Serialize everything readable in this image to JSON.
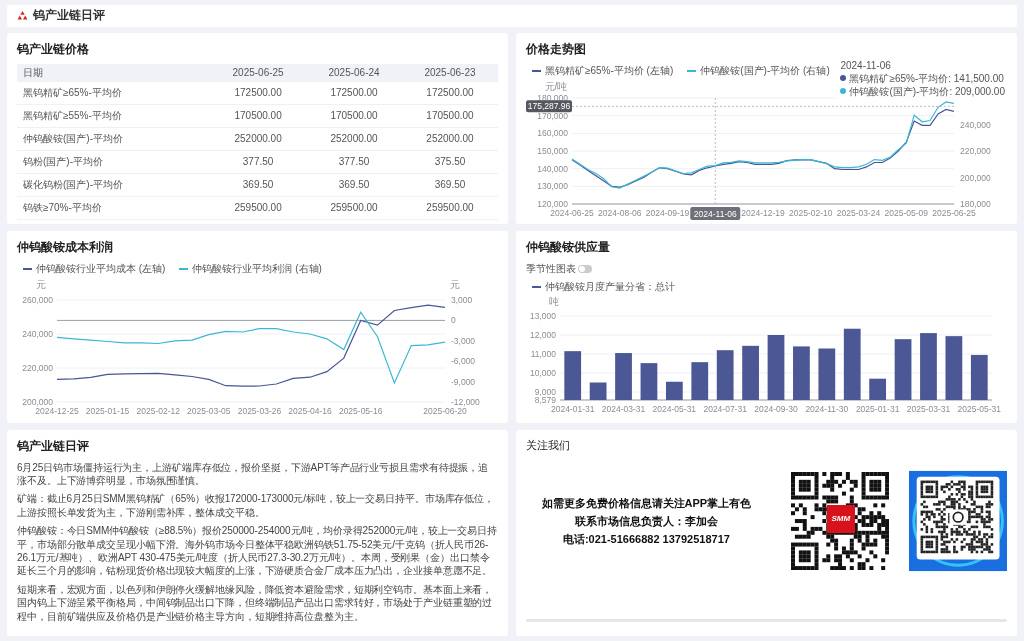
{
  "header": {
    "title": "钨产业链日评"
  },
  "price_table": {
    "title": "钨产业链价格",
    "columns": [
      "日期",
      "2025-06-25",
      "2025-06-24",
      "2025-06-23"
    ],
    "rows": [
      [
        "黑钨精矿≥65%-平均价",
        "172500.00",
        "172500.00",
        "172500.00"
      ],
      [
        "黑钨精矿≥55%-平均价",
        "170500.00",
        "170500.00",
        "170500.00"
      ],
      [
        "仲钨酸铵(国产)-平均价",
        "252000.00",
        "252000.00",
        "252000.00"
      ],
      [
        "钨粉(国产)-平均价",
        "377.50",
        "377.50",
        "375.50"
      ],
      [
        "碳化钨粉(国产)-平均价",
        "369.50",
        "369.50",
        "369.50"
      ],
      [
        "钨铁≥70%-平均价",
        "259500.00",
        "259500.00",
        "259500.00"
      ]
    ]
  },
  "price_trend": {
    "title": "价格走势图",
    "chart_data": {
      "type": "line",
      "ylabel": "元/吨",
      "grid": true,
      "categories": [
        "2024-06-25",
        null,
        null,
        null,
        null,
        null,
        "2024-08-06",
        null,
        null,
        null,
        null,
        null,
        "2024-09-19",
        null,
        null,
        null,
        null,
        null,
        "2024-11-06",
        null,
        null,
        null,
        null,
        null,
        "2024-12-19",
        null,
        null,
        null,
        null,
        null,
        "2025-02-10",
        null,
        null,
        null,
        null,
        null,
        "2025-03-24",
        null,
        null,
        null,
        null,
        null,
        "2025-05-09",
        null,
        null,
        null,
        null,
        null,
        "2025-06-25"
      ],
      "ylim": [
        120000,
        180000
      ],
      "yticks": [
        {
          "value": 120000,
          "label": "120,000"
        },
        {
          "value": 130000,
          "label": "130,000"
        },
        {
          "value": 140000,
          "label": "140,000"
        },
        {
          "value": 150000,
          "label": "150,000"
        },
        {
          "value": 160000,
          "label": "160,000"
        },
        {
          "value": 170000,
          "label": "170,000"
        },
        {
          "value": 180000,
          "label": "180,000"
        }
      ],
      "y2lim": [
        180000,
        260000
      ],
      "y2ticks": [
        {
          "value": 180000,
          "label": "180,000"
        },
        {
          "value": 200000,
          "label": "200,000"
        },
        {
          "value": 220000,
          "label": "220,000"
        },
        {
          "value": 240000,
          "label": "240,000"
        }
      ],
      "series": [
        {
          "name": "黑钨精矿≥65%-平均价 (左轴)",
          "color": "#4a5596",
          "values": [
            145000,
            142000,
            139000,
            136000,
            133000,
            130000,
            129500,
            131000,
            133000,
            135000,
            138000,
            140500,
            140000,
            138500,
            137000,
            136500,
            139000,
            140500,
            141500,
            142500,
            143000,
            144000,
            143500,
            142500,
            142500,
            142500,
            143000,
            144500,
            145000,
            145000,
            145000,
            144000,
            143000,
            140000,
            139500,
            139500,
            139500,
            141000,
            143500,
            143500,
            146000,
            150000,
            155000,
            167000,
            164500,
            164500,
            171000,
            173500,
            172500
          ]
        },
        {
          "name": "仲钨酸铵(国产)-平均价 (右轴)",
          "color": "#3bb6d6",
          "axis": "y2",
          "values": [
            214000,
            210000,
            206000,
            203000,
            199000,
            193000,
            192000,
            195000,
            198000,
            201000,
            204000,
            207500,
            207000,
            205000,
            203000,
            203500,
            206000,
            208500,
            209000,
            211000,
            211500,
            212500,
            212000,
            211000,
            211000,
            211000,
            211500,
            212500,
            213000,
            213500,
            213500,
            212000,
            210500,
            208000,
            207500,
            207500,
            208000,
            210000,
            213500,
            213000,
            215500,
            221000,
            226000,
            247000,
            242000,
            243000,
            253000,
            257000,
            256000
          ]
        }
      ],
      "ref_lines": [
        {
          "axis": "x",
          "value": "2024-11-06"
        },
        {
          "axis": "y",
          "value": 175287.96,
          "label": "175,287.96"
        }
      ]
    },
    "tooltip": {
      "title": "2024-11-06",
      "items": [
        {
          "label": "黑钨精矿≥65%-平均价: 141,500.00",
          "color": "#4a5596"
        },
        {
          "label": "仲钨酸铵(国产)-平均价: 209,000.00",
          "color": "#3bb6d6"
        }
      ]
    }
  },
  "cost_profit": {
    "title": "仲钨酸铵成本利润",
    "chart_data": {
      "type": "line",
      "ylabel": "元",
      "y2label": "元",
      "grid": true,
      "categories": [
        "2024-12-25",
        null,
        null,
        "2025-01-15",
        null,
        null,
        "2025-02-12",
        null,
        null,
        "2025-03-05",
        null,
        null,
        "2025-03-26",
        null,
        null,
        "2025-04-16",
        null,
        null,
        "2025-05-16",
        null,
        null,
        null,
        null,
        "2025-06-20"
      ],
      "ylim": [
        200000,
        260000
      ],
      "yticks": [
        {
          "value": 200000,
          "label": "200,000"
        },
        {
          "value": 220000,
          "label": "220,000"
        },
        {
          "value": 240000,
          "label": "240,000"
        },
        {
          "value": 260000,
          "label": "260,000"
        }
      ],
      "y2lim": [
        -12000,
        3000
      ],
      "y2ticks": [
        {
          "value": -12000,
          "label": "-12,000"
        },
        {
          "value": -9000,
          "label": "-9,000"
        },
        {
          "value": -6000,
          "label": "-6,000"
        },
        {
          "value": -3000,
          "label": "-3,000"
        },
        {
          "value": 0,
          "label": "0"
        },
        {
          "value": 3000,
          "label": "3,000"
        }
      ],
      "series": [
        {
          "name": "仲钨酸铵行业平均成本 (左轴)",
          "color": "#4a5596",
          "values": [
            213300,
            213600,
            214500,
            216300,
            216600,
            216700,
            216800,
            216000,
            215000,
            213300,
            209600,
            209300,
            209400,
            210600,
            213900,
            214600,
            217900,
            225800,
            248000,
            245200,
            253800,
            255500,
            257000,
            255700
          ]
        },
        {
          "name": "仲钨酸铵行业平均利润 (右轴)",
          "color": "#3bb6d6",
          "axis": "y2",
          "values": [
            -2500,
            -2700,
            -2900,
            -3100,
            -3300,
            -3300,
            -3400,
            -3000,
            -2900,
            -2100,
            -1600,
            -1700,
            -1200,
            -1200,
            -1700,
            -2000,
            -2700,
            -4300,
            1200,
            -2400,
            -9200,
            -3700,
            -3600,
            -3200
          ]
        }
      ]
    }
  },
  "supply": {
    "title": "仲钨酸铵供应量",
    "toggle": {
      "label": "季节性图表",
      "on": false
    },
    "chart_data": {
      "type": "bar",
      "ylabel": "吨",
      "grid": true,
      "categories": [
        "2024-01-31",
        null,
        "2024-03-31",
        null,
        "2024-05-31",
        null,
        "2024-07-31",
        null,
        "2024-09-30",
        null,
        "2024-11-30",
        null,
        "2025-01-31",
        null,
        "2025-03-31",
        null,
        "2025-05-31"
      ],
      "ylim": [
        8579,
        13000
      ],
      "yticks": [
        {
          "value": 8579,
          "label": "8,579"
        },
        {
          "value": 9000,
          "label": "9,000"
        },
        {
          "value": 10000,
          "label": "10,000"
        },
        {
          "value": 11000,
          "label": "11,000"
        },
        {
          "value": 12000,
          "label": "12,000"
        },
        {
          "value": 13000,
          "label": "13,000"
        }
      ],
      "series": [
        {
          "name": "仲钨酸铵月度产量分省：总计",
          "color": "#4c5796",
          "values": [
            11150,
            9500,
            11050,
            10520,
            9540,
            10570,
            11200,
            11430,
            12000,
            11400,
            11290,
            12330,
            9700,
            11780,
            12100,
            11940,
            10950
          ]
        }
      ]
    }
  },
  "commentary": {
    "title": "钨产业链日评",
    "paragraphs": [
      "6月25日钨市场僵持运行为主，上游矿端库存低位，报价坚挺，下游APT等产品行业亏损且需求有待提振，追涨不及。上下游博弈明显，市场氛围谨慎。",
      "矿端：截止6月25日SMM黑钨精矿（65%）收报172000-173000元/标吨，较上一交易日持平。市场库存低位，上游按照长单发货为主，下游刚需补库，整体成交平稳。",
      "仲钨酸铵：今日SMM仲钨酸铵（≥88.5%）报价250000-254000元/吨，均价录得252000元/吨，较上一交易日持平，市场部分散单成交呈现小幅下滑。海外钨市场今日整体平稳欧洲钨铁51.75-52美元/千克钨（折人民币26-26.1万元/基吨）、欧洲APT 430-475美元/吨度（折人民币27.3-30.2万元/吨）。本周，受刚果（金）出口禁令延长三个月的影响，钴粉现货价格出现较大幅度的上涨，下游硬质合金厂成本压力凸出，企业接单意愿不足。",
      "短期来看，宏观方面，以色列和伊朗停火缓解地缘风险，降低资本避险需求，短期利空钨市。基本面上来看，国内钨上下游呈紧平衡格局，中间钨制品出口下降，但终端制品产品出口需求转好，市场处于产业链重塑的过程中，目前矿端供应及价格仍是产业链价格主导方向，短期维持高位盘整为主。"
    ]
  },
  "follow_us": {
    "title": "关注我们",
    "lines": [
      "如需更多免费价格信息请关注APP掌上有色",
      "联系市场信息负责人：李加会",
      "电话:021-51666882 13792518717"
    ],
    "qr_logo": "SMM"
  }
}
